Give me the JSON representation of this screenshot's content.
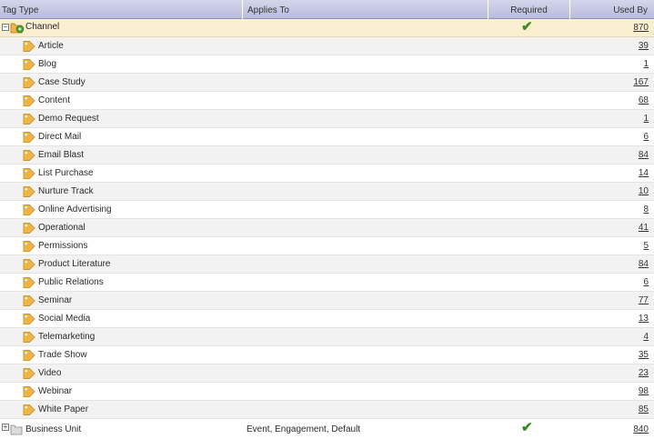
{
  "columns": {
    "tag_type": "Tag Type",
    "applies_to": "Applies To",
    "required": "Required",
    "used_by": "Used By"
  },
  "parent": {
    "label": "Channel",
    "required": "✔",
    "count": "870"
  },
  "children": [
    {
      "label": "Article",
      "count": "39"
    },
    {
      "label": "Blog",
      "count": "1"
    },
    {
      "label": "Case Study",
      "count": "167"
    },
    {
      "label": "Content",
      "count": "68"
    },
    {
      "label": "Demo Request",
      "count": "1"
    },
    {
      "label": "Direct Mail",
      "count": "6"
    },
    {
      "label": "Email Blast",
      "count": "84"
    },
    {
      "label": "List Purchase",
      "count": "14"
    },
    {
      "label": "Nurture Track",
      "count": "10"
    },
    {
      "label": "Online Advertising",
      "count": "8"
    },
    {
      "label": "Operational",
      "count": "41"
    },
    {
      "label": "Permissions",
      "count": "5"
    },
    {
      "label": "Product Literature",
      "count": "84"
    },
    {
      "label": "Public Relations",
      "count": "6"
    },
    {
      "label": "Seminar",
      "count": "77"
    },
    {
      "label": "Social Media",
      "count": "13"
    },
    {
      "label": "Telemarketing",
      "count": "4"
    },
    {
      "label": "Trade Show",
      "count": "35"
    },
    {
      "label": "Video",
      "count": "23"
    },
    {
      "label": "Webinar",
      "count": "98"
    },
    {
      "label": "White Paper",
      "count": "85"
    }
  ],
  "next_row_partial": {
    "label": "Business Unit",
    "applies_to": "Event, Engagement, Default",
    "required": "✔",
    "count": "840"
  },
  "colors": {
    "header_top": "#d4d6ec",
    "header_bottom": "#b9bcdb",
    "parent_row": "#fbefd2",
    "alt_row": "#f2f2f2",
    "check_green": "#3c8a1e",
    "tag_orange": "#f0b34a"
  }
}
